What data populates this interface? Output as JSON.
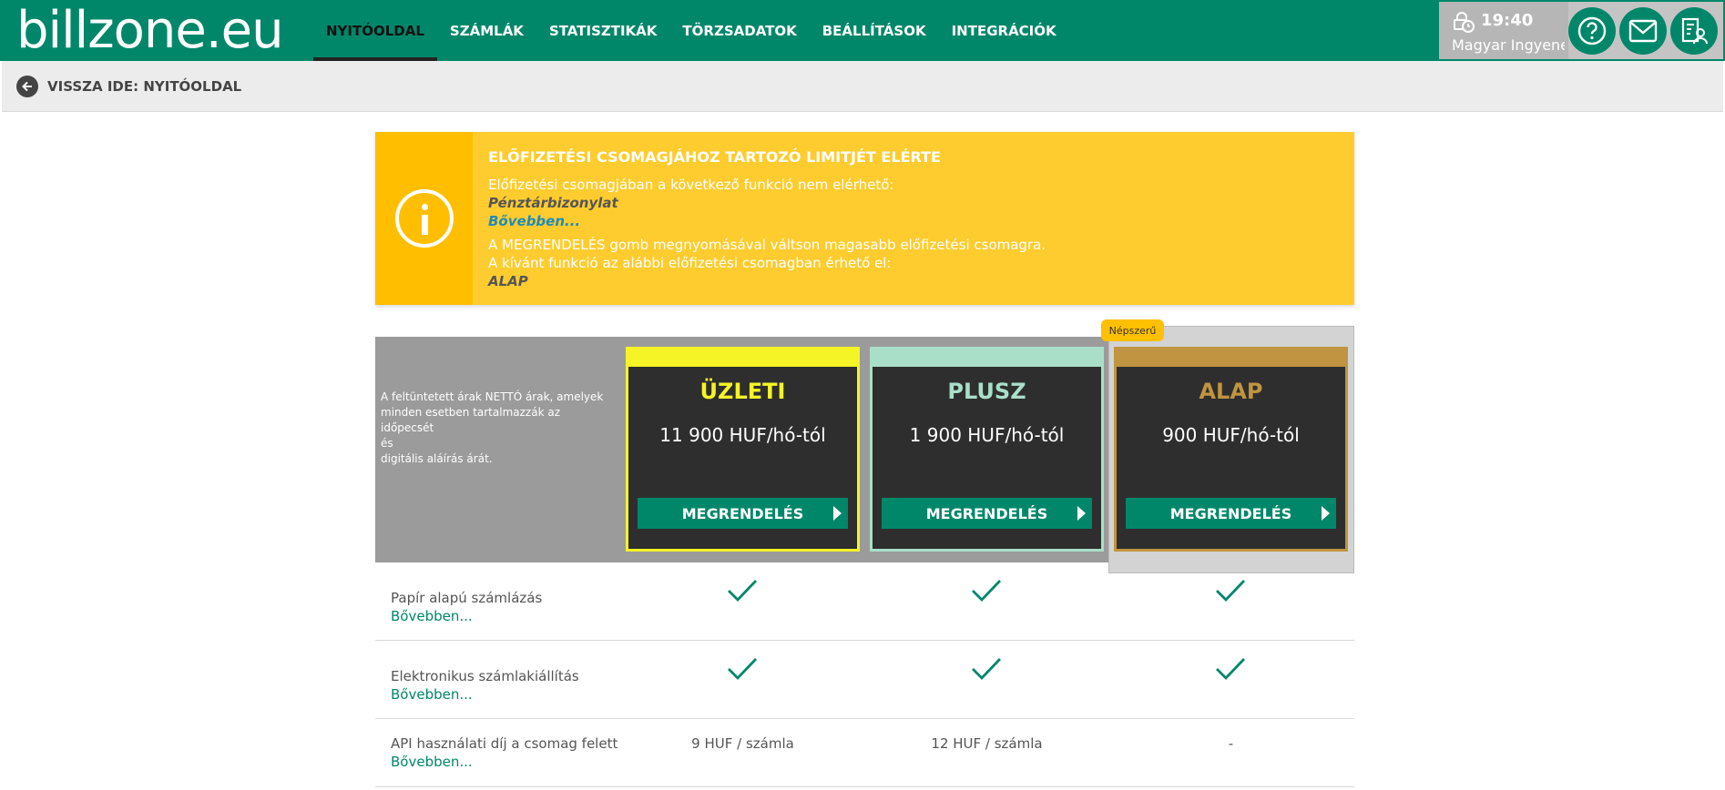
{
  "header": {
    "logo": "billzone.eu",
    "nav": [
      {
        "label": "NYITÓOLDAL",
        "active": true
      },
      {
        "label": "SZÁMLÁK"
      },
      {
        "label": "STATISZTIKÁK"
      },
      {
        "label": "TÖRZSADATOK"
      },
      {
        "label": "BEÁLLÍTÁSOK"
      },
      {
        "label": "INTEGRÁCIÓK"
      }
    ],
    "session": {
      "time": "19:40",
      "user": "Magyar Ingyene..."
    }
  },
  "subbar": {
    "back_label": "VISSZA IDE: NYITÓOLDAL"
  },
  "alert": {
    "title": "ELŐFIZETÉSI CSOMAGJÁHOZ TARTOZÓ LIMITJÉT ELÉRTE",
    "line1": "Előfizetési csomagjában a következő funkció nem elérhető:",
    "feature": "Pénztárbizonylat",
    "more": "Bővebben...",
    "line2": "A MEGRENDELÉS gomb megnyomásával váltson magasabb előfizetési csomagra.",
    "line3": "A kívánt funkció az alábbi előfizetési csomagban érhető el:",
    "plan": "ALAP"
  },
  "plans": {
    "note_lines": [
      "A feltüntetett árak NETTÓ árak, amelyek",
      "minden esetben tartalmazzák az időpecsét",
      "és",
      "digitális aláírás árát."
    ],
    "popular_badge": "Népszerű",
    "order_label": "MEGRENDELÉS",
    "items": [
      {
        "name": "ÜZLETI",
        "price": "11 900 HUF/hó-tól",
        "color": "#f4f426"
      },
      {
        "name": "PLUSZ",
        "price": "1 900 HUF/hó-tól",
        "color": "#a9dfc8"
      },
      {
        "name": "ALAP",
        "price": "900 HUF/hó-tól",
        "color": "#c09440"
      }
    ]
  },
  "features": [
    {
      "label": "Papír alapú számlázás",
      "more": "Bővebben...",
      "values": [
        "check",
        "check",
        "check"
      ]
    },
    {
      "label": "Elektronikus számlakiállítás",
      "more": "Bővebben...",
      "values": [
        "check",
        "check",
        "check"
      ]
    },
    {
      "label": "API használati díj a csomag felett",
      "more": "Bővebben...",
      "values": [
        "9 HUF / számla",
        "12 HUF / számla",
        "-"
      ]
    }
  ],
  "colors": {
    "brand": "#00876a",
    "alert": "#ffcc2f",
    "alert_dark": "#ffbf00"
  }
}
